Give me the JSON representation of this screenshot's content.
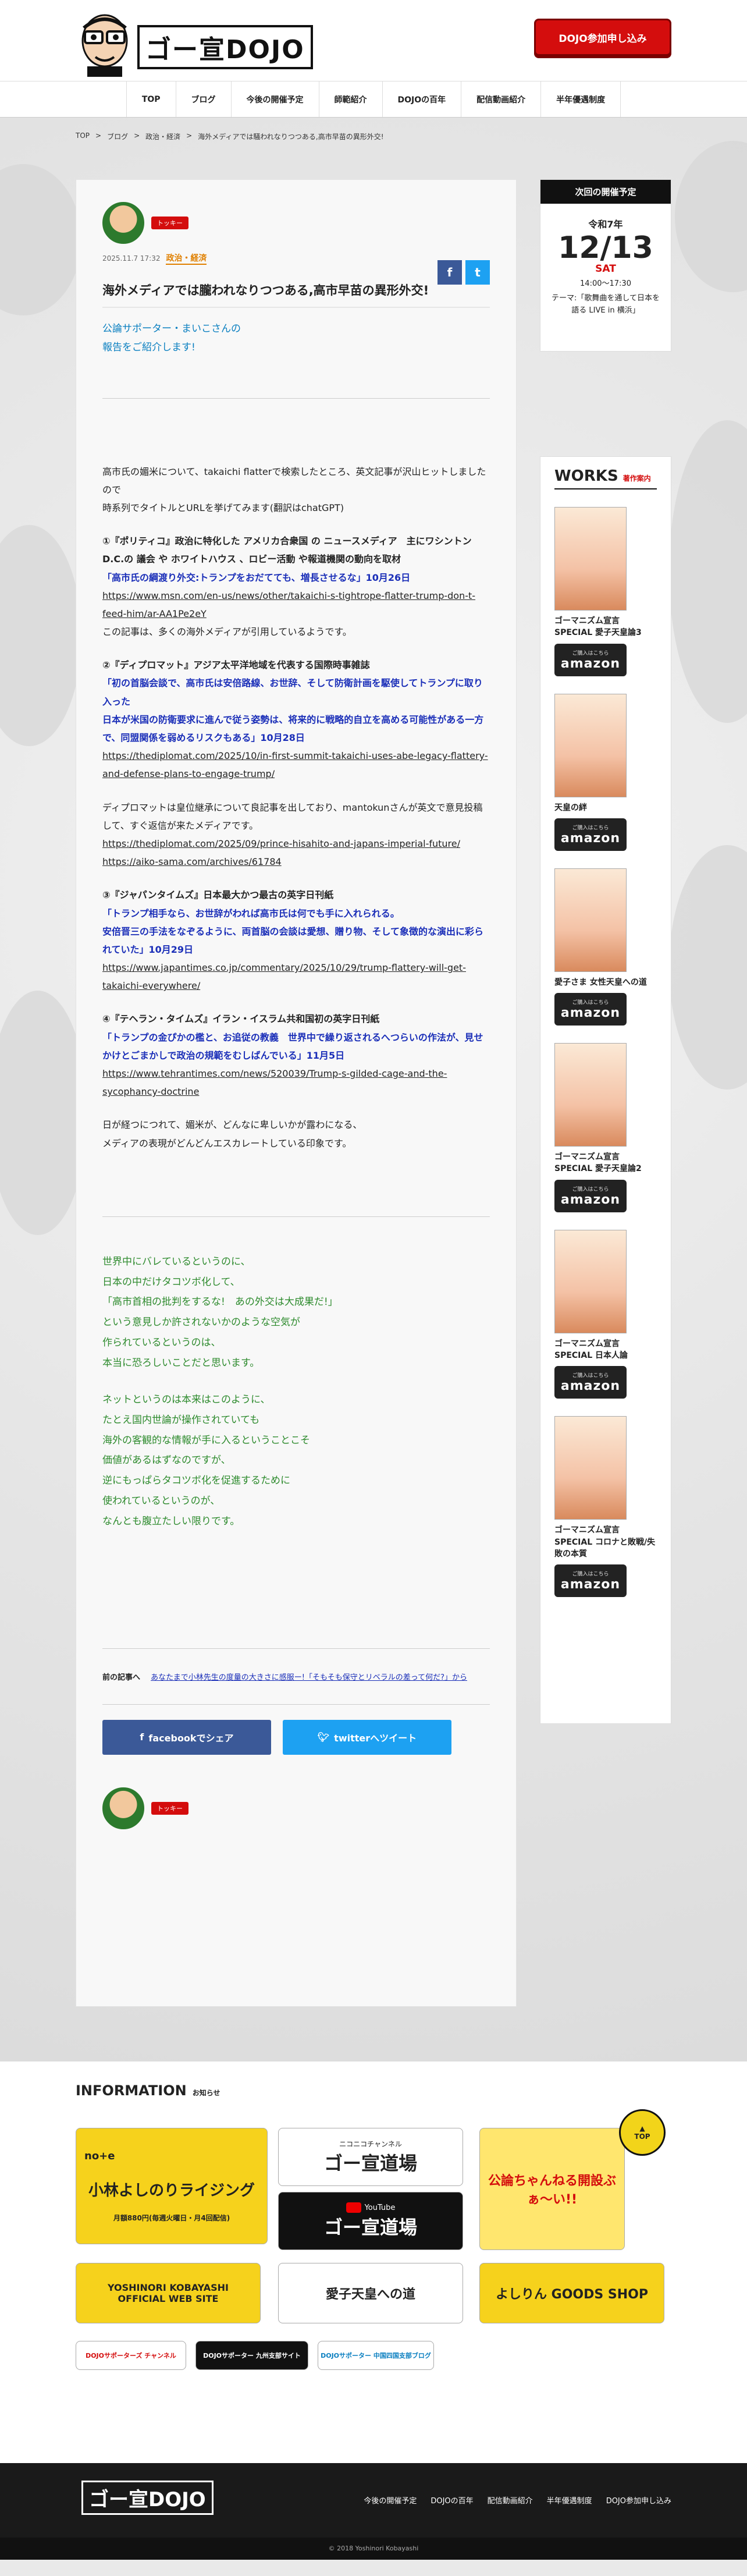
{
  "header": {
    "logo_text": "ゴー宣DOJO",
    "join_button": "DOJO参加申し込み"
  },
  "nav": [
    "TOP",
    "ブログ",
    "今後の開催予定",
    "師範紹介",
    "DOJOの百年",
    "配信動画紹介",
    "半年優遇制度"
  ],
  "breadcrumb": [
    "TOP",
    "ブログ",
    "政治・経済",
    "海外メディアでは騒われなりつつある,高市早苗の異形外交!"
  ],
  "article": {
    "author_tag": "トッキー",
    "date": "2025.11.7 17:32",
    "category": "政治・経済",
    "title": "海外メディアでは朧われなりつつある,高市早苗の異形外交!",
    "intro": [
      "公論サポーター・まいこさんの",
      "報告をご紹介します!"
    ],
    "p1": [
      "高市氏の媚米について、takaichi flatterで検索したところ、英文記事が沢山ヒットしましたので",
      "時系列でタイトルとURLを挙げてみます(翻訳はchatGPT)"
    ],
    "s1": {
      "head": "①『ポリティコ』政治に特化した アメリカ合衆国 の ニュースメディア　主にワシントンD.C.の 議会 や ホワイトハウス 、ロビー活動 や報道機関の動向を取材",
      "quote": "「高市氏の綱渡り外交:トランプをおだてても、増長させるな」10月26日",
      "url": "https://www.msn.com/en-us/news/other/takaichi-s-tightrope-flatter-trump-don-t-feed-him/ar-AA1Pe2eY",
      "note": "この記事は、多くの海外メディアが引用しているようです。"
    },
    "s2": {
      "head": "②『ディプロマット』アジア太平洋地域を代表する国際時事雑誌",
      "quote1": "「初の首脳会談で、高市氏は安倍路線、お世辞、そして防衛計画を駆使してトランプに取り入った",
      "quote2": "日本が米国の防衛要求に進んで従う姿勢は、将来的に戦略的自立を高める可能性がある一方で、同盟関係を弱めるリスクもある」10月28日",
      "url": "https://thediplomat.com/2025/10/in-first-summit-takaichi-uses-abe-legacy-flattery-and-defense-plans-to-engage-trump/"
    },
    "p2": "ディプロマットは皇位継承について良記事を出しており、mantokunさんが英文で意見投稿して、すぐ返信が来たメディアです。",
    "p2_urls": [
      "https://thediplomat.com/2025/09/prince-hisahito-and-japans-imperial-future/",
      "https://aiko-sama.com/archives/61784"
    ],
    "s3": {
      "head": "③『ジャパンタイムズ』日本最大かつ最古の英字日刊紙",
      "quote1": "「トランプ相手なら、お世辞がわれば高市氏は何でも手に入れられる。",
      "quote2": "安倍晋三の手法をなぞるように、両首脳の会談は愛想、贈り物、そして象徴的な演出に彩られていた」10月29日",
      "url": "https://www.japantimes.co.jp/commentary/2025/10/29/trump-flattery-will-get-takaichi-everywhere/"
    },
    "s4": {
      "head": "④『テヘラン・タイムズ』イラン・イスラム共和国初の英字日刊紙",
      "quote": "「トランプの金ぴかの檻と、お追従の教義　世界中で繰り返されるへつらいの作法が、見せかけとごまかしで政治の規範をむしばんでいる」11月5日",
      "url": "https://www.tehrantimes.com/news/520039/Trump-s-gilded-cage-and-the-sycophancy-doctrine"
    },
    "p3": [
      "日が経つにつれて、媚米が、どんなに卑しいかが露わになる、",
      "メディアの表現がどんどんエスカレートしている印象です。"
    ],
    "green1": [
      "世界中にバレているというのに、",
      "日本の中だけタコツボ化して、",
      "「高市首相の批判をするな!　あの外交は大成果だ!」",
      "という意見しか許されないかのような空気が",
      "作られているというのは、",
      "本当に恐ろしいことだと思います。"
    ],
    "green2": [
      "ネットというのは本来はこのように、",
      "たとえ国内世論が操作されていても",
      "海外の客観的な情報が手に入るということこそ",
      "価値があるはずなのですが、",
      "逆にもっぱらタコツボ化を促進するために",
      "使われているというのが、",
      "なんとも腹立たしい限りです。"
    ],
    "prev_label": "前の記事へ",
    "prev_link": "あなたまで小林先生の度量の大きさに感服ー!「そもそも保守とリベラルの差って何だ?」から",
    "fb_share": "facebookでシェア",
    "tw_share": "twitterへツイート"
  },
  "sidebar": {
    "event_head": "次回の開催予定",
    "event_year": "令和7年",
    "event_date": "12/13",
    "event_dow": "SAT",
    "event_time": "14:00〜17:30",
    "event_theme": "テーマ:「歌舞曲を通して日本を語る LIVE in 横浜」",
    "works_title": "WORKS",
    "works_sub": "著作案内",
    "amazon_small": "ご購入はこちら",
    "amazon": "amazon",
    "works": [
      {
        "name": "ゴーマニズム宣言SPECIAL 愛子天皇論3"
      },
      {
        "name": "天皇の絆"
      },
      {
        "name": "愛子さま 女性天皇への道"
      },
      {
        "name": "ゴーマニズム宣言SPECIAL 愛子天皇論2"
      },
      {
        "name": "ゴーマニズム宣言SPECIAL 日本人論"
      },
      {
        "name": "ゴーマニズム宣言SPECIAL コロナと敗戦/失敗の本質"
      }
    ]
  },
  "info": {
    "title": "INFORMATION",
    "sub": "お知らせ",
    "tiles": {
      "note": "小林よしのりライジング",
      "note_price": "月額880円(毎週火曜日・月4回配信)",
      "nico": "ニコニコチャンネル",
      "nico_main": "ゴー宣道場",
      "yt": "YouTube",
      "yt_main": "ゴー宣道場",
      "koron": "公論ちゃんねる開設ぶぁ〜い!!",
      "official": "YOSHINORI KOBAYASHI OFFICIAL WEB SITE",
      "aiko": "愛子天皇への道",
      "goods": "よしりん GOODS SHOP",
      "b1": "DOJOサポーターズ チャンネル",
      "b2": "DOJOサポーター 九州支部サイト",
      "b3": "DOJOサポーター 中国四国支部ブログ"
    },
    "top": "TOP"
  },
  "footer": {
    "logo": "ゴー宣DOJO",
    "nav": [
      "今後の開催予定",
      "DOJOの百年",
      "配信動画紹介",
      "半年優遇制度",
      "DOJO参加申し込み"
    ],
    "copyright": "© 2018 Yoshinori Kobayashi"
  }
}
